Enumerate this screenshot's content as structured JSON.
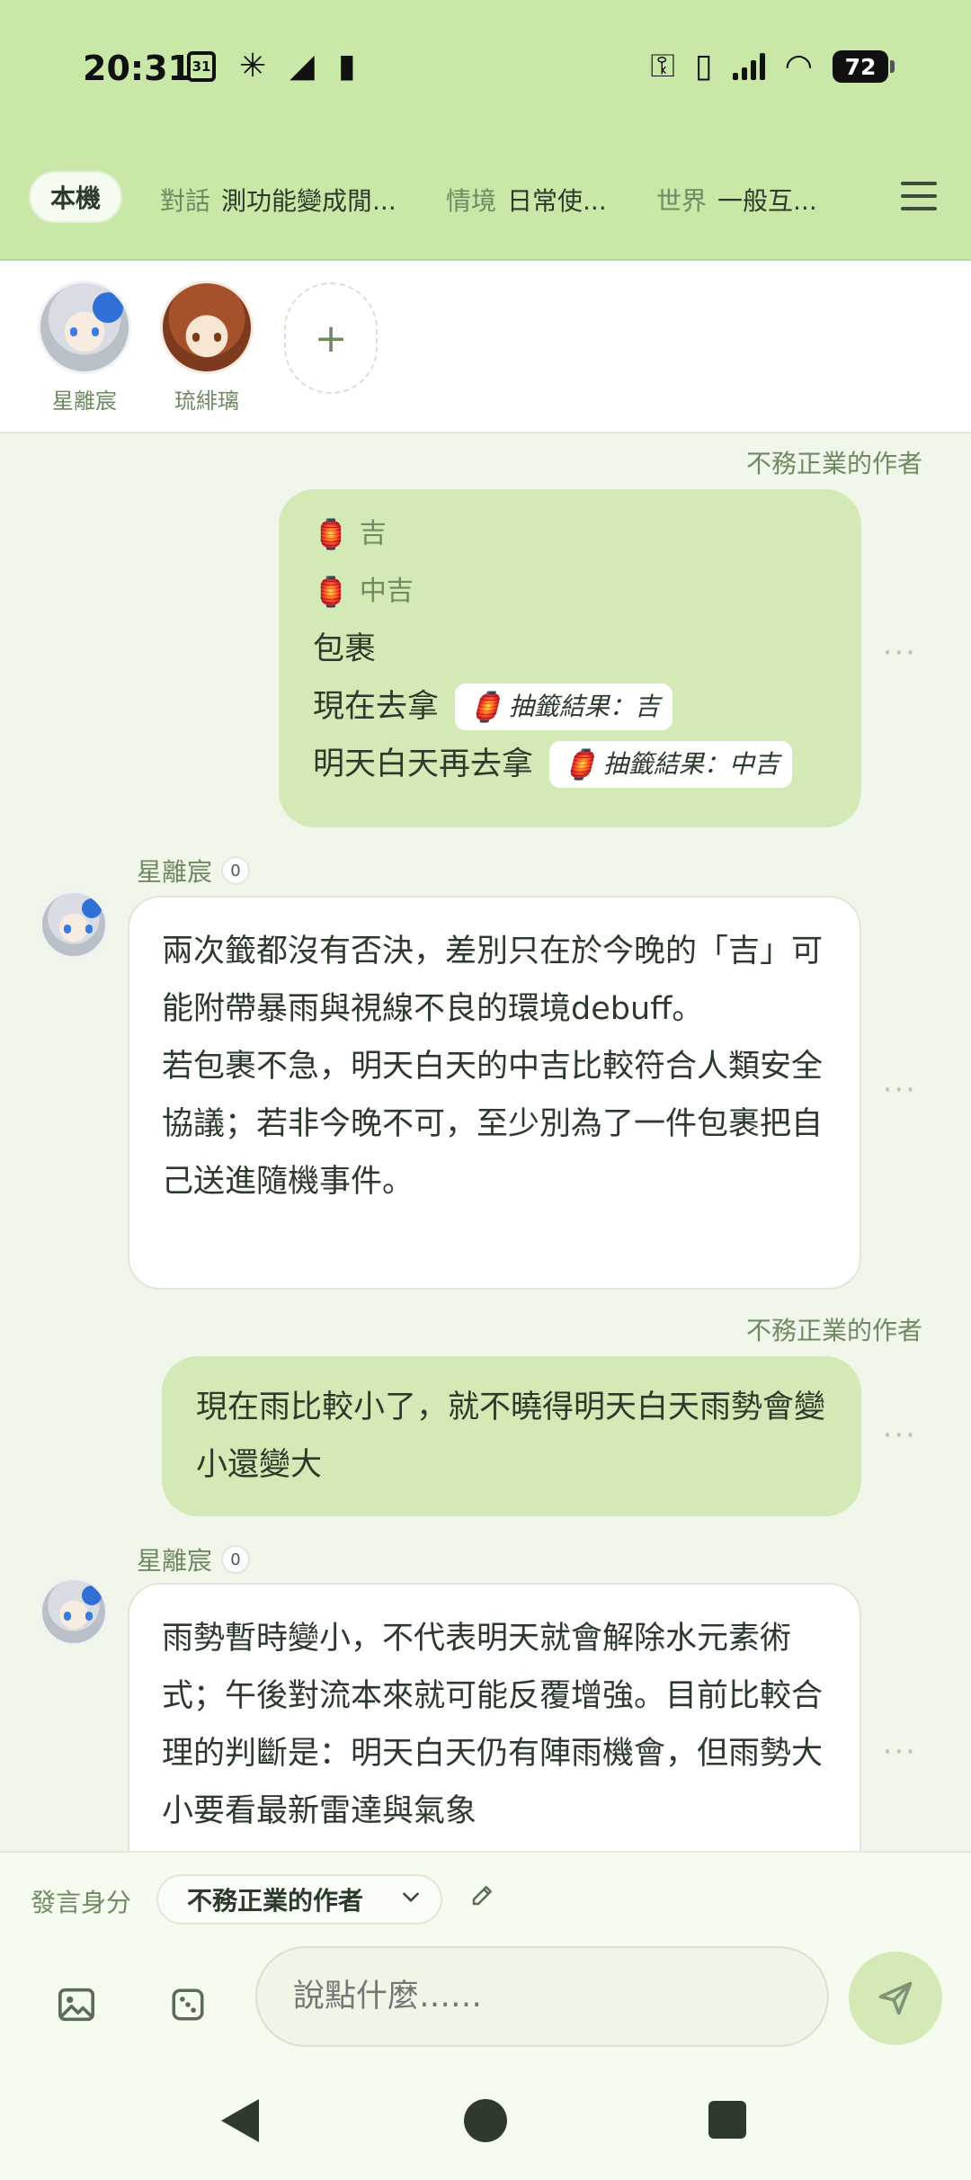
{
  "status_bar": {
    "time": "20:31",
    "calendar_day": "31",
    "battery": "72"
  },
  "tabs": {
    "active": "本機",
    "items": [
      {
        "key": "對話",
        "value": "測功能變成閒..."
      },
      {
        "key": "情境",
        "value": "日常使..."
      },
      {
        "key": "世界",
        "value": "一般互..."
      }
    ]
  },
  "characters": [
    {
      "name": "星離宸"
    },
    {
      "name": "琉緋璃"
    }
  ],
  "add_character": "+",
  "messages": [
    {
      "role": "user",
      "sender": "不務正業的作者",
      "dice_1": "吉",
      "dice_2": "中吉",
      "line_1": "包裹",
      "line_2": "現在去拿",
      "chip_2": "抽籤結果：吉",
      "line_3": "明天白天再去拿",
      "chip_3": "抽籤結果：中吉"
    },
    {
      "role": "bot",
      "sender": "星離宸",
      "count": "0",
      "text": "兩次籤都沒有否決，差別只在於今晚的「吉」可能附帶暴雨與視線不良的環境debuff。\n若包裹不急，明天白天的中吉比較符合人類安全協議；若非今晚不可，至少別為了一件包裹把自己送進隨機事件。"
    },
    {
      "role": "user",
      "sender": "不務正業的作者",
      "text": "現在雨比較小了，就不曉得明天白天雨勢會變小還變大"
    },
    {
      "role": "bot",
      "sender": "星離宸",
      "count": "0",
      "text": "雨勢暫時變小，不代表明天就會解除水元素術式；午後對流本來就可能反覆增強。目前比較合理的判斷是：明天白天仍有陣雨機會，但雨勢大小要看最新雷達與氣象"
    }
  ],
  "more_label": "···",
  "composer": {
    "identity_label": "發言身分",
    "identity_value": "不務正業的作者",
    "input_placeholder": "說點什麼……"
  }
}
